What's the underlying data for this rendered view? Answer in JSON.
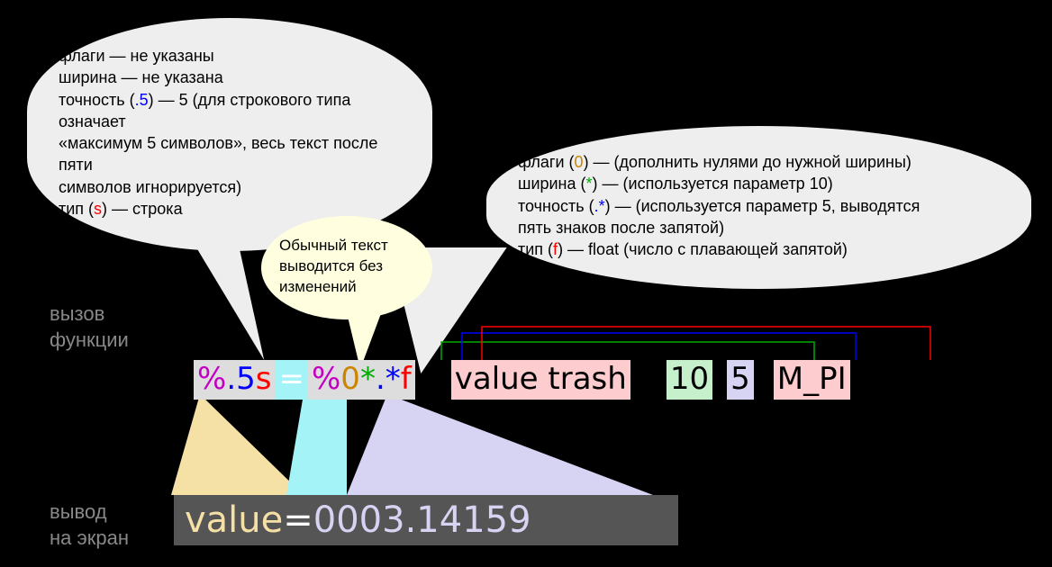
{
  "labels": {
    "call_line1": "вызов",
    "call_line2": "функции",
    "out_line1": "вывод",
    "out_line2": "на экран"
  },
  "bubble_left": {
    "l1": "флаги — не указаны",
    "l2": "ширина — не указана",
    "l3a": "точность (",
    "l3b": ".5",
    "l3c": ") — 5 (для строкового типа означает",
    "l4": "«максимум 5 символов», весь текст после пяти",
    "l5": "символов игнорируется)",
    "l6a": "тип (",
    "l6b": "s",
    "l6c": ") — строка"
  },
  "bubble_mid": {
    "l1": "Обычный текст",
    "l2": "выводится без",
    "l3": "изменений"
  },
  "bubble_right": {
    "l1a": "флаги (",
    "l1b": "0",
    "l1c": ") — (дополнить нулями до нужной ширины)",
    "l2a": "ширина (",
    "l2b": "*",
    "l2c": ") — (используется параметр 10)",
    "l3a": "точность (",
    "l3b": ".*",
    "l3c": ") — (используется параметр 5, выводятся",
    "l4": "пять знаков после запятой)",
    "l5a": "тип (",
    "l5b": "f",
    "l5c": ") — float (число с плавающей запятой)"
  },
  "code": {
    "pct": "%",
    "dot5": ".5",
    "s": "s",
    "eq": " = ",
    "pct2": "%",
    "zero": "0",
    "star": "*",
    "dot": ".",
    "star2": "*",
    "f": "f",
    "value_trash": "value trash",
    "ten": "10",
    "five": "5",
    "mpi": "M_PI"
  },
  "output": {
    "value": "value",
    "eq": "  = ",
    "num": "0003.14159"
  }
}
